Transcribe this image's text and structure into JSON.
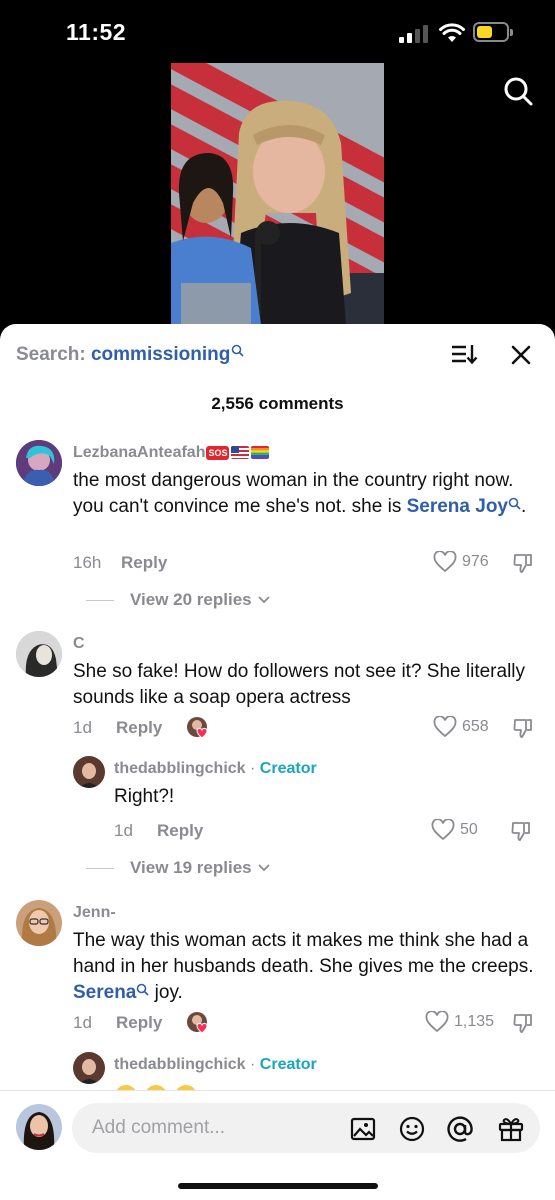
{
  "status_bar": {
    "time": "11:52"
  },
  "sheet": {
    "search_prefix": "Search: ",
    "search_term": "commissioning",
    "comment_count": "2,556 comments"
  },
  "comments": [
    {
      "username": "LezbanaAnteafah",
      "badges": [
        "SOS",
        "us-flag",
        "rainbow-flag"
      ],
      "text_before": "the most dangerous woman in the country right now. you can't convince me she's not. she is ",
      "link_text": "Serena Joy",
      "text_after": ".",
      "time": "16h",
      "reply_label": "Reply",
      "likes": "976",
      "view_replies": "View 20 replies"
    },
    {
      "username": "C",
      "text": "She so fake! How do followers not see it? She literally sounds like a soap opera actress",
      "time": "1d",
      "reply_label": "Reply",
      "likes": "658",
      "reply": {
        "username": "thedabblingchick",
        "creator_dot": " · ",
        "creator_label": "Creator",
        "text": "Right?!",
        "time": "1d",
        "reply_label": "Reply",
        "likes": "50"
      },
      "view_replies": "View 19 replies"
    },
    {
      "username": "Jenn-",
      "text_before": "The way this woman acts it makes me think she had a hand in her husbands death. She gives me the creeps. ",
      "link_text": "Serena",
      "text_after": " joy.",
      "time": "1d",
      "reply_label": "Reply",
      "likes": "1,135",
      "reply": {
        "username": "thedabblingchick",
        "creator_dot": " · ",
        "creator_label": "Creator"
      }
    }
  ],
  "bottom_bar": {
    "placeholder": "Add comment..."
  }
}
